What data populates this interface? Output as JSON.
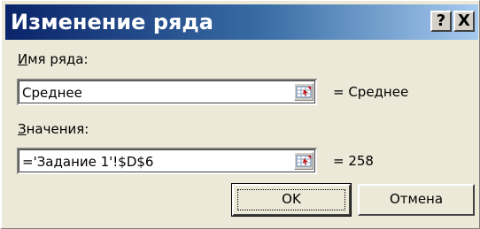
{
  "dialog": {
    "title": "Изменение ряда",
    "help_button": "?",
    "close_button": "X"
  },
  "series_name": {
    "label_accel": "И",
    "label_rest": "мя ряда:",
    "value": "Среднее",
    "result": "= Среднее"
  },
  "series_values": {
    "label_accel": "З",
    "label_rest": "начения:",
    "value": "='Задание 1'!$D$6",
    "result": "= 258"
  },
  "buttons": {
    "ok": "OK",
    "cancel": "Отмена"
  },
  "icons": {
    "range_select": "range-select-icon"
  }
}
